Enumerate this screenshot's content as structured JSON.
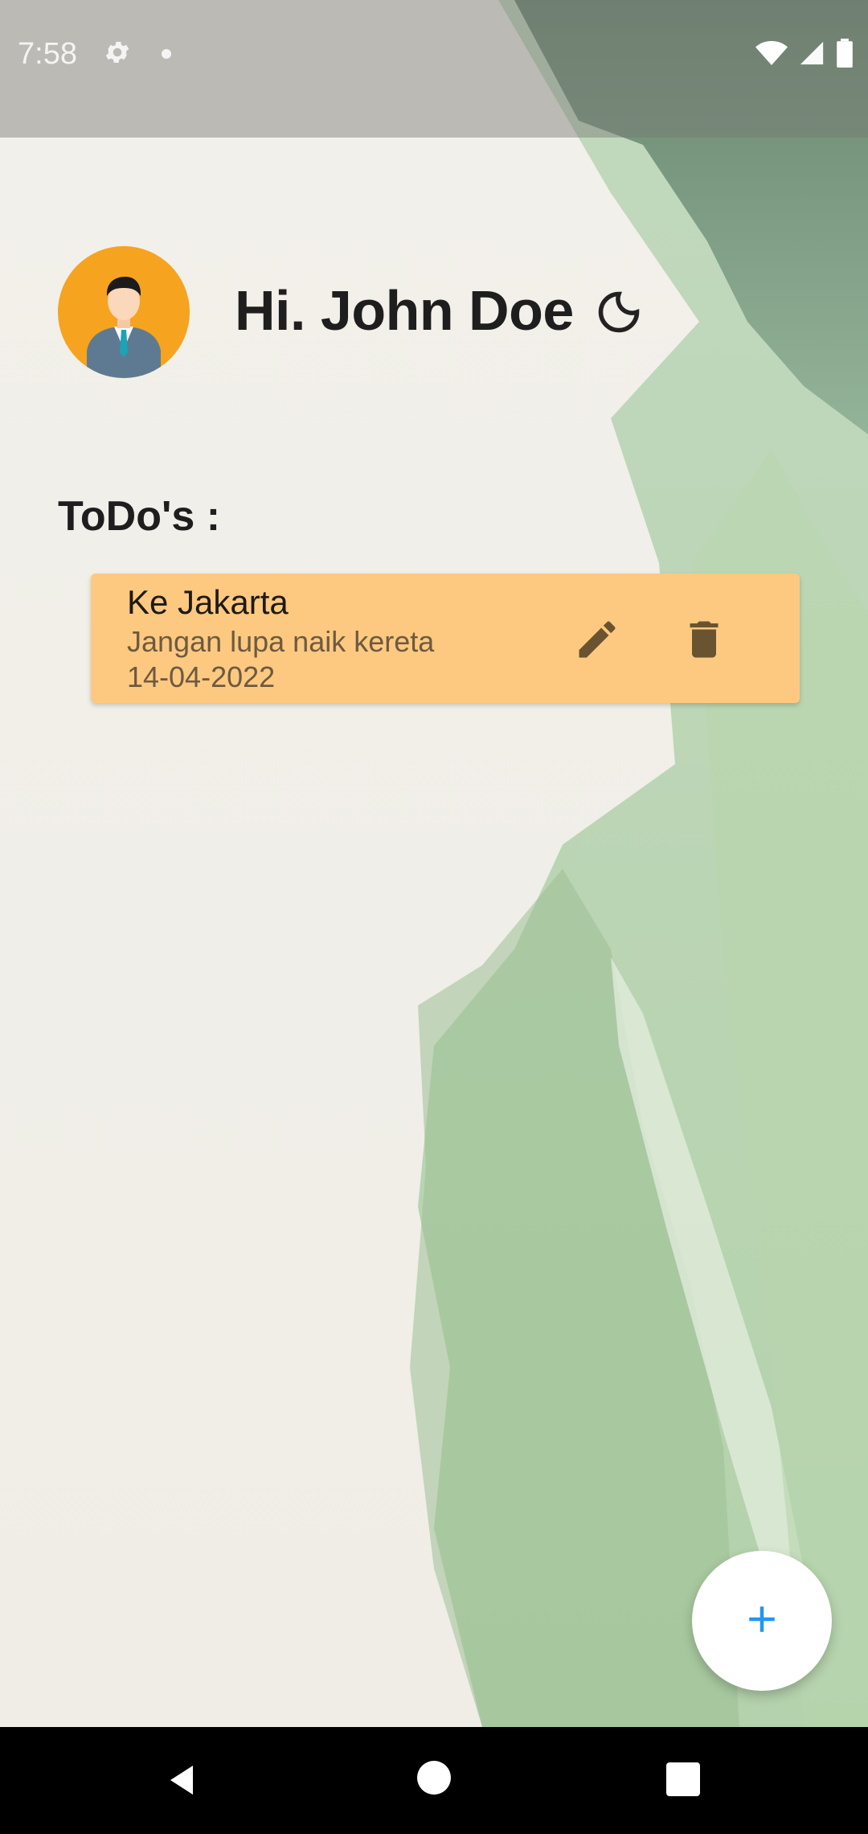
{
  "status_bar": {
    "time": "7:58",
    "icons": [
      "settings-icon",
      "notification-dot-icon",
      "wifi-icon",
      "signal-icon",
      "battery-icon"
    ]
  },
  "header": {
    "greeting": "Hi. John Doe",
    "avatar_icon": "user-avatar-icon",
    "theme_icon": "moon-icon"
  },
  "todos": {
    "title": "ToDo's :",
    "items": [
      {
        "title": "Ke Jakarta",
        "description": "Jangan lupa naik kereta",
        "date": "14-04-2022",
        "edit_icon": "pencil-icon",
        "delete_icon": "trash-icon"
      }
    ]
  },
  "fab": {
    "icon": "plus-icon"
  },
  "navigation": {
    "icons": [
      "back-icon",
      "home-icon",
      "recents-icon"
    ]
  },
  "colors": {
    "card": "#fdc981",
    "avatar_bg": "#f6a31f",
    "fab_icon": "#2196f3",
    "text": "#1e1e1e"
  }
}
